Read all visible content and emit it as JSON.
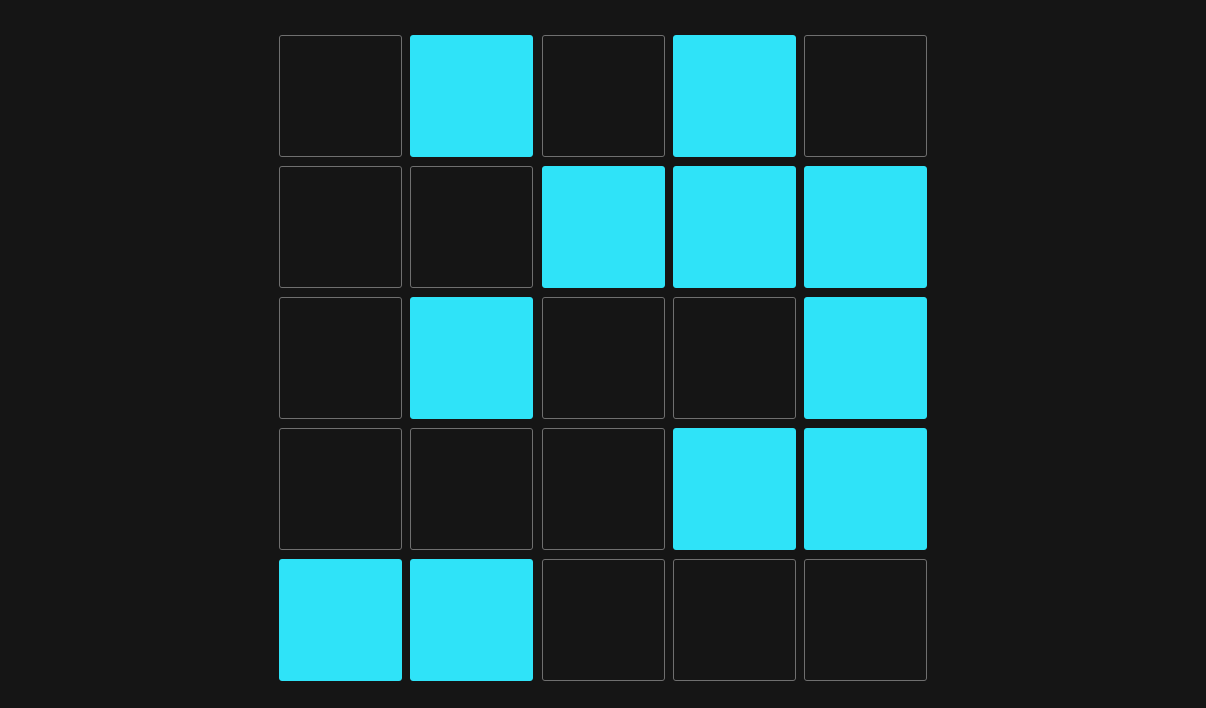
{
  "colors": {
    "background": "#151515",
    "cell_on": "#2fe3f8",
    "cell_off": "#151515",
    "cell_border": "#6f6f6f"
  },
  "grid": {
    "rows": 5,
    "cols": 5,
    "cells": [
      [
        0,
        1,
        0,
        1,
        0
      ],
      [
        0,
        0,
        1,
        1,
        1
      ],
      [
        0,
        1,
        0,
        0,
        1
      ],
      [
        0,
        0,
        0,
        1,
        1
      ],
      [
        1,
        1,
        0,
        0,
        0
      ]
    ]
  }
}
